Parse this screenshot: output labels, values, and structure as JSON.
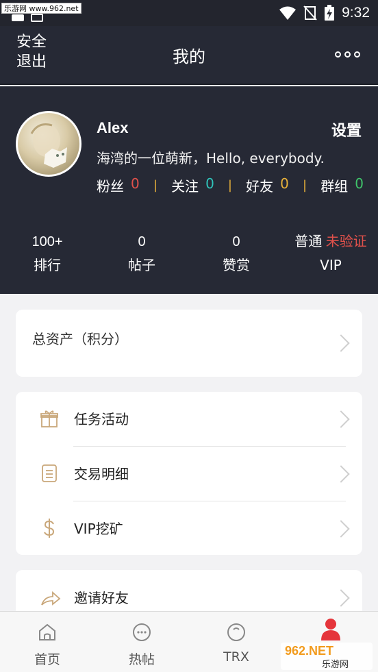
{
  "status_bar": {
    "watermark": "乐游网 www.962.net",
    "time": "9:32"
  },
  "header": {
    "logout_label": "安全退出",
    "title": "我的",
    "more_icon": "more-icon"
  },
  "profile": {
    "username": "Alex",
    "settings_label": "设置",
    "bio": "海湾的一位萌新，Hello, everybody.",
    "stats": [
      {
        "label": "粉丝",
        "value": "0",
        "color": "#e0514b"
      },
      {
        "label": "关注",
        "value": "0",
        "color": "#2fc4bb"
      },
      {
        "label": "好友",
        "value": "0",
        "color": "#e9b23a"
      },
      {
        "label": "群组",
        "value": "0",
        "color": "#3fc46a"
      }
    ],
    "separator": "|",
    "metrics": [
      {
        "value": "100+",
        "label": "排行"
      },
      {
        "value": "0",
        "label": "帖子"
      },
      {
        "value": "0",
        "label": "赞赏"
      },
      {
        "prefix": "普通",
        "status": "未验证",
        "label": "VIP",
        "status_color": "#e0514b"
      }
    ]
  },
  "assets": {
    "label": "总资产（积分）"
  },
  "menu": [
    {
      "label": "任务活动",
      "icon": "gift-icon"
    },
    {
      "label": "交易明细",
      "icon": "document-icon"
    },
    {
      "label": "VIP挖矿",
      "icon": "dollar-icon"
    }
  ],
  "invite": {
    "label": "邀请好友",
    "icon": "share-icon"
  },
  "tabs": [
    {
      "label": "首页",
      "icon": "home-icon"
    },
    {
      "label": "热帖",
      "icon": "chat-icon"
    },
    {
      "label": "TRX",
      "icon": "trx-icon"
    },
    {
      "label": "",
      "icon": "profile-icon"
    }
  ],
  "logo_overlay": {
    "top_text": "962.NET",
    "bottom_text": "乐游网"
  },
  "colors": {
    "dark_bg": "#262935",
    "accent_gold": "#e9b23a",
    "icon_tan": "#c9a77a",
    "active_red": "#e5353b"
  }
}
